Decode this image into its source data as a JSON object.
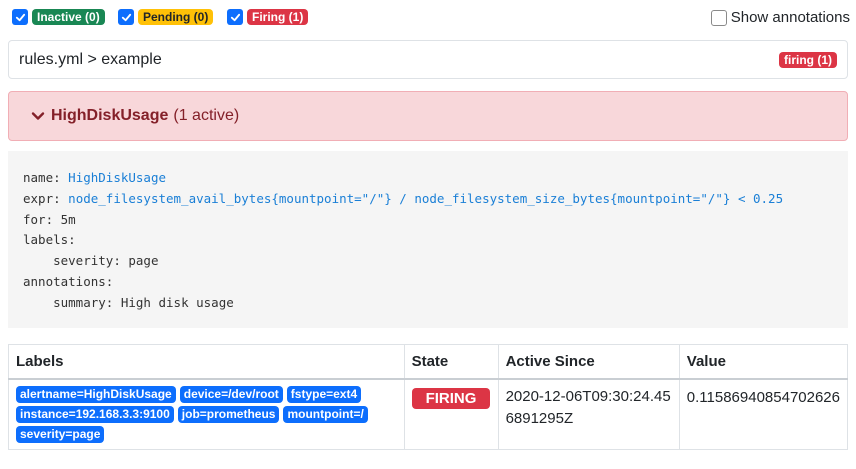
{
  "filters": {
    "inactive": {
      "label": "Inactive (0)",
      "checked": true
    },
    "pending": {
      "label": "Pending (0)",
      "checked": true
    },
    "firing": {
      "label": "Firing (1)",
      "checked": true
    },
    "show_annotations": {
      "label": "Show annotations",
      "checked": false
    }
  },
  "group": {
    "path": "rules.yml > example",
    "badge": "firing (1)"
  },
  "rule": {
    "name": "HighDiskUsage",
    "count": "(1 active)",
    "code": {
      "k_name": "name:",
      "name": "HighDiskUsage",
      "k_expr": "expr:",
      "expr": "node_filesystem_avail_bytes{mountpoint=\"/\"} / node_filesystem_size_bytes{mountpoint=\"/\"} < 0.25",
      "k_for": "for:",
      "for": "5m",
      "k_labels": "labels:",
      "k_severity": "severity:",
      "severity": "page",
      "k_annotations": "annotations:",
      "k_summary": "summary:",
      "summary": "High disk usage"
    }
  },
  "table": {
    "headers": {
      "labels": "Labels",
      "state": "State",
      "active_since": "Active Since",
      "value": "Value"
    },
    "rows": [
      {
        "labels": [
          "alertname=HighDiskUsage",
          "device=/dev/root",
          "fstype=ext4",
          "instance=192.168.3.3:9100",
          "job=prometheus",
          "mountpoint=/",
          "severity=page"
        ],
        "state": "FIRING",
        "active_since": "2020-12-06T09:30:24.456891295Z",
        "value": "0.11586940854702626"
      }
    ]
  },
  "colors": {
    "primary": "#0d6efd",
    "success": "#198754",
    "warning": "#ffc107",
    "danger": "#dc3545",
    "alert_bg": "#f8d7da",
    "code_value": "#1a7fd6"
  },
  "icons": {
    "checkbox": "checkmark-icon",
    "toggle": "chevron-down-icon"
  }
}
